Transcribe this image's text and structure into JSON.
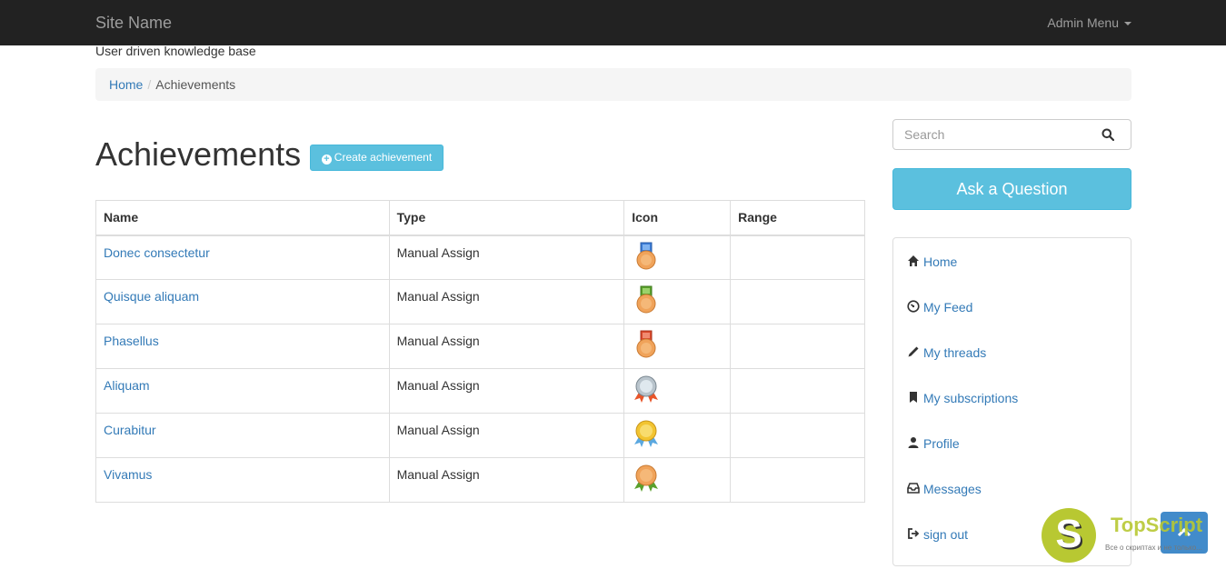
{
  "navbar": {
    "brand": "Site Name",
    "admin_menu": "Admin Menu"
  },
  "tagline": "User driven knowledge base",
  "breadcrumb": {
    "home": "Home",
    "current": "Achievements"
  },
  "main": {
    "title": "Achievements",
    "create_button": "Create achievement",
    "table": {
      "headers": [
        "Name",
        "Type",
        "Icon",
        "Range"
      ],
      "rows": [
        {
          "name": "Donec consectetur",
          "type": "Manual Assign",
          "icon": "medal-blue-ribbon-bronze-icon",
          "range": ""
        },
        {
          "name": "Quisque aliquam",
          "type": "Manual Assign",
          "icon": "medal-green-ribbon-bronze-icon",
          "range": ""
        },
        {
          "name": "Phasellus",
          "type": "Manual Assign",
          "icon": "medal-red-ribbon-bronze-icon",
          "range": ""
        },
        {
          "name": "Aliquam",
          "type": "Manual Assign",
          "icon": "rosette-silver-icon",
          "range": ""
        },
        {
          "name": "Curabitur",
          "type": "Manual Assign",
          "icon": "rosette-gold-icon",
          "range": ""
        },
        {
          "name": "Vivamus",
          "type": "Manual Assign",
          "icon": "rosette-bronze-icon",
          "range": ""
        }
      ]
    }
  },
  "sidebar": {
    "search_placeholder": "Search",
    "ask_button": "Ask a Question",
    "menu": [
      {
        "label": "Home",
        "icon": "home-icon"
      },
      {
        "label": "My Feed",
        "icon": "dashboard-icon"
      },
      {
        "label": "My threads",
        "icon": "pencil-icon"
      },
      {
        "label": "My subscriptions",
        "icon": "bookmark-icon"
      },
      {
        "label": "Profile",
        "icon": "user-icon"
      },
      {
        "label": "Messages",
        "icon": "inbox-icon"
      },
      {
        "label": "sign out",
        "icon": "log-out-icon"
      }
    ]
  },
  "watermark": {
    "logo_letter": "S",
    "title": "TopScript",
    "subtitle": "Все о скриптах и не только..."
  },
  "colors": {
    "navbar_bg": "#222222",
    "link": "#337ab7",
    "info_button": "#5bc0de",
    "scroll_top_button": "#428bca",
    "watermark_green": "#b8c832"
  }
}
